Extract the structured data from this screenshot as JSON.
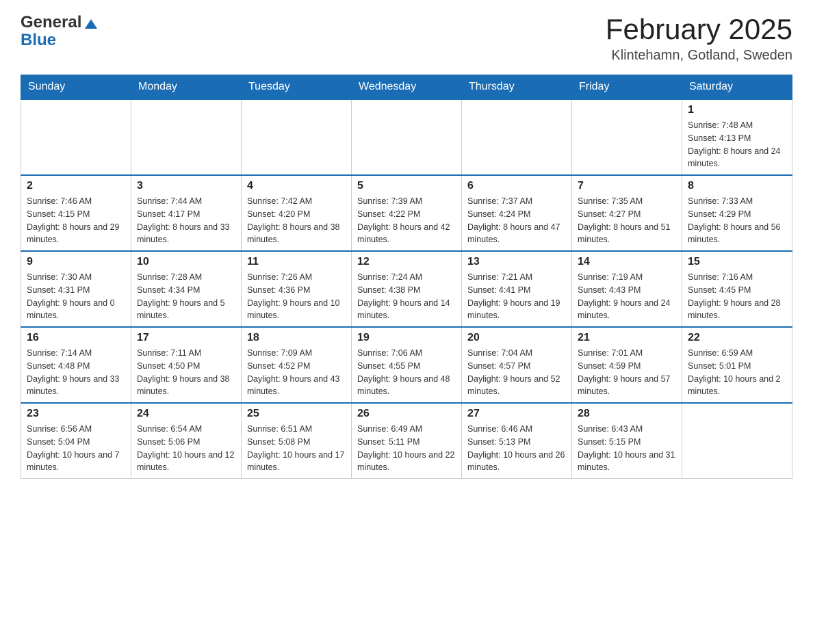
{
  "logo": {
    "general": "General",
    "blue": "Blue"
  },
  "title": "February 2025",
  "subtitle": "Klintehamn, Gotland, Sweden",
  "days_of_week": [
    "Sunday",
    "Monday",
    "Tuesday",
    "Wednesday",
    "Thursday",
    "Friday",
    "Saturday"
  ],
  "weeks": [
    [
      null,
      null,
      null,
      null,
      null,
      null,
      {
        "day": "1",
        "sunrise": "Sunrise: 7:48 AM",
        "sunset": "Sunset: 4:13 PM",
        "daylight": "Daylight: 8 hours and 24 minutes."
      }
    ],
    [
      {
        "day": "2",
        "sunrise": "Sunrise: 7:46 AM",
        "sunset": "Sunset: 4:15 PM",
        "daylight": "Daylight: 8 hours and 29 minutes."
      },
      {
        "day": "3",
        "sunrise": "Sunrise: 7:44 AM",
        "sunset": "Sunset: 4:17 PM",
        "daylight": "Daylight: 8 hours and 33 minutes."
      },
      {
        "day": "4",
        "sunrise": "Sunrise: 7:42 AM",
        "sunset": "Sunset: 4:20 PM",
        "daylight": "Daylight: 8 hours and 38 minutes."
      },
      {
        "day": "5",
        "sunrise": "Sunrise: 7:39 AM",
        "sunset": "Sunset: 4:22 PM",
        "daylight": "Daylight: 8 hours and 42 minutes."
      },
      {
        "day": "6",
        "sunrise": "Sunrise: 7:37 AM",
        "sunset": "Sunset: 4:24 PM",
        "daylight": "Daylight: 8 hours and 47 minutes."
      },
      {
        "day": "7",
        "sunrise": "Sunrise: 7:35 AM",
        "sunset": "Sunset: 4:27 PM",
        "daylight": "Daylight: 8 hours and 51 minutes."
      },
      {
        "day": "8",
        "sunrise": "Sunrise: 7:33 AM",
        "sunset": "Sunset: 4:29 PM",
        "daylight": "Daylight: 8 hours and 56 minutes."
      }
    ],
    [
      {
        "day": "9",
        "sunrise": "Sunrise: 7:30 AM",
        "sunset": "Sunset: 4:31 PM",
        "daylight": "Daylight: 9 hours and 0 minutes."
      },
      {
        "day": "10",
        "sunrise": "Sunrise: 7:28 AM",
        "sunset": "Sunset: 4:34 PM",
        "daylight": "Daylight: 9 hours and 5 minutes."
      },
      {
        "day": "11",
        "sunrise": "Sunrise: 7:26 AM",
        "sunset": "Sunset: 4:36 PM",
        "daylight": "Daylight: 9 hours and 10 minutes."
      },
      {
        "day": "12",
        "sunrise": "Sunrise: 7:24 AM",
        "sunset": "Sunset: 4:38 PM",
        "daylight": "Daylight: 9 hours and 14 minutes."
      },
      {
        "day": "13",
        "sunrise": "Sunrise: 7:21 AM",
        "sunset": "Sunset: 4:41 PM",
        "daylight": "Daylight: 9 hours and 19 minutes."
      },
      {
        "day": "14",
        "sunrise": "Sunrise: 7:19 AM",
        "sunset": "Sunset: 4:43 PM",
        "daylight": "Daylight: 9 hours and 24 minutes."
      },
      {
        "day": "15",
        "sunrise": "Sunrise: 7:16 AM",
        "sunset": "Sunset: 4:45 PM",
        "daylight": "Daylight: 9 hours and 28 minutes."
      }
    ],
    [
      {
        "day": "16",
        "sunrise": "Sunrise: 7:14 AM",
        "sunset": "Sunset: 4:48 PM",
        "daylight": "Daylight: 9 hours and 33 minutes."
      },
      {
        "day": "17",
        "sunrise": "Sunrise: 7:11 AM",
        "sunset": "Sunset: 4:50 PM",
        "daylight": "Daylight: 9 hours and 38 minutes."
      },
      {
        "day": "18",
        "sunrise": "Sunrise: 7:09 AM",
        "sunset": "Sunset: 4:52 PM",
        "daylight": "Daylight: 9 hours and 43 minutes."
      },
      {
        "day": "19",
        "sunrise": "Sunrise: 7:06 AM",
        "sunset": "Sunset: 4:55 PM",
        "daylight": "Daylight: 9 hours and 48 minutes."
      },
      {
        "day": "20",
        "sunrise": "Sunrise: 7:04 AM",
        "sunset": "Sunset: 4:57 PM",
        "daylight": "Daylight: 9 hours and 52 minutes."
      },
      {
        "day": "21",
        "sunrise": "Sunrise: 7:01 AM",
        "sunset": "Sunset: 4:59 PM",
        "daylight": "Daylight: 9 hours and 57 minutes."
      },
      {
        "day": "22",
        "sunrise": "Sunrise: 6:59 AM",
        "sunset": "Sunset: 5:01 PM",
        "daylight": "Daylight: 10 hours and 2 minutes."
      }
    ],
    [
      {
        "day": "23",
        "sunrise": "Sunrise: 6:56 AM",
        "sunset": "Sunset: 5:04 PM",
        "daylight": "Daylight: 10 hours and 7 minutes."
      },
      {
        "day": "24",
        "sunrise": "Sunrise: 6:54 AM",
        "sunset": "Sunset: 5:06 PM",
        "daylight": "Daylight: 10 hours and 12 minutes."
      },
      {
        "day": "25",
        "sunrise": "Sunrise: 6:51 AM",
        "sunset": "Sunset: 5:08 PM",
        "daylight": "Daylight: 10 hours and 17 minutes."
      },
      {
        "day": "26",
        "sunrise": "Sunrise: 6:49 AM",
        "sunset": "Sunset: 5:11 PM",
        "daylight": "Daylight: 10 hours and 22 minutes."
      },
      {
        "day": "27",
        "sunrise": "Sunrise: 6:46 AM",
        "sunset": "Sunset: 5:13 PM",
        "daylight": "Daylight: 10 hours and 26 minutes."
      },
      {
        "day": "28",
        "sunrise": "Sunrise: 6:43 AM",
        "sunset": "Sunset: 5:15 PM",
        "daylight": "Daylight: 10 hours and 31 minutes."
      },
      null
    ]
  ]
}
